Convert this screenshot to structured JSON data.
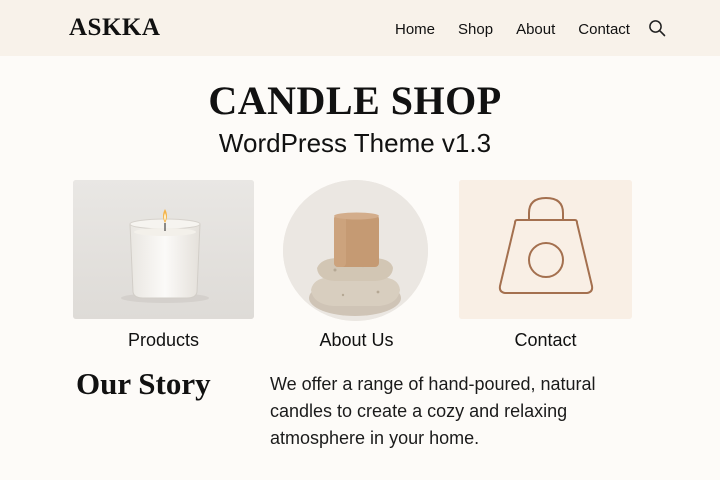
{
  "header": {
    "logo": "ASKKA",
    "nav": [
      {
        "label": "Home"
      },
      {
        "label": "Shop"
      },
      {
        "label": "About"
      },
      {
        "label": "Contact"
      }
    ],
    "search_icon": "search-icon"
  },
  "hero": {
    "title": "CANDLE SHOP",
    "subtitle": "WordPress Theme v1.3"
  },
  "cards": [
    {
      "label": "Products",
      "image": "candle-jar-image"
    },
    {
      "label": "About Us",
      "image": "pillar-candle-on-stones-image"
    },
    {
      "label": "Contact",
      "image": "shopping-bag-icon"
    }
  ],
  "story": {
    "heading": "Our Story",
    "text": "We offer a range of hand-poured, natural candles to create a cozy and relaxing atmosphere in your home."
  },
  "colors": {
    "header_bg": "#f8f2ea",
    "page_bg": "#fdfbf8",
    "accent_brown": "#a4704f"
  }
}
